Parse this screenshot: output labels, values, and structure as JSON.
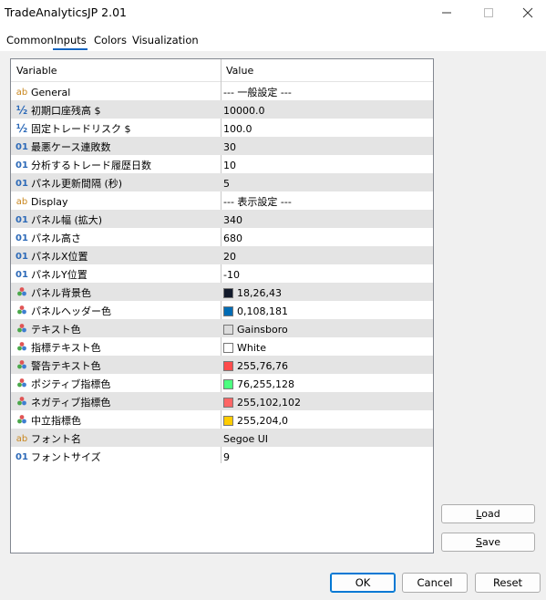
{
  "window": {
    "title": "TradeAnalyticsJP 2.01"
  },
  "tabs": [
    {
      "label": "Common",
      "active": false
    },
    {
      "label": "Inputs",
      "active": true
    },
    {
      "label": "Colors",
      "active": false
    },
    {
      "label": "Visualization",
      "active": false
    }
  ],
  "grid": {
    "headers": {
      "variable": "Variable",
      "value": "Value"
    },
    "rows": [
      {
        "icon": "ab",
        "name": "General",
        "value": "--- 一般設定 ---"
      },
      {
        "icon": "half",
        "name": "初期口座残高 $",
        "value": "10000.0"
      },
      {
        "icon": "half",
        "name": "固定トレードリスク $",
        "value": "100.0"
      },
      {
        "icon": "01",
        "name": "最悪ケース連敗数",
        "value": "30"
      },
      {
        "icon": "01",
        "name": "分析するトレード履歴日数",
        "value": "10"
      },
      {
        "icon": "01",
        "name": "パネル更新間隔 (秒)",
        "value": "5"
      },
      {
        "icon": "ab",
        "name": "Display",
        "value": "--- 表示設定 ---"
      },
      {
        "icon": "01",
        "name": "パネル幅 (拡大)",
        "value": "340"
      },
      {
        "icon": "01",
        "name": "パネル高さ",
        "value": "680"
      },
      {
        "icon": "01",
        "name": "パネルX位置",
        "value": "20"
      },
      {
        "icon": "01",
        "name": "パネルY位置",
        "value": "-10"
      },
      {
        "icon": "color",
        "name": "パネル背景色",
        "value": "18,26,43",
        "swatch": "#121a2b"
      },
      {
        "icon": "color",
        "name": "パネルヘッダー色",
        "value": "0,108,181",
        "swatch": "#006cb5"
      },
      {
        "icon": "color",
        "name": "テキスト色",
        "value": "Gainsboro",
        "swatch": "#dcdcdc"
      },
      {
        "icon": "color",
        "name": "指標テキスト色",
        "value": "White",
        "swatch": "#ffffff"
      },
      {
        "icon": "color",
        "name": "警告テキスト色",
        "value": "255,76,76",
        "swatch": "#ff4c4c"
      },
      {
        "icon": "color",
        "name": "ポジティブ指標色",
        "value": "76,255,128",
        "swatch": "#4cff80"
      },
      {
        "icon": "color",
        "name": "ネガティブ指標色",
        "value": "255,102,102",
        "swatch": "#ff6666"
      },
      {
        "icon": "color",
        "name": "中立指標色",
        "value": "255,204,0",
        "swatch": "#ffcc00"
      },
      {
        "icon": "ab",
        "name": "フォント名",
        "value": "Segoe UI"
      },
      {
        "icon": "01",
        "name": "フォントサイズ",
        "value": "9"
      }
    ]
  },
  "side_buttons": {
    "load": "Load",
    "save": "Save"
  },
  "bottom_buttons": {
    "ok": "OK",
    "cancel": "Cancel",
    "reset": "Reset"
  }
}
